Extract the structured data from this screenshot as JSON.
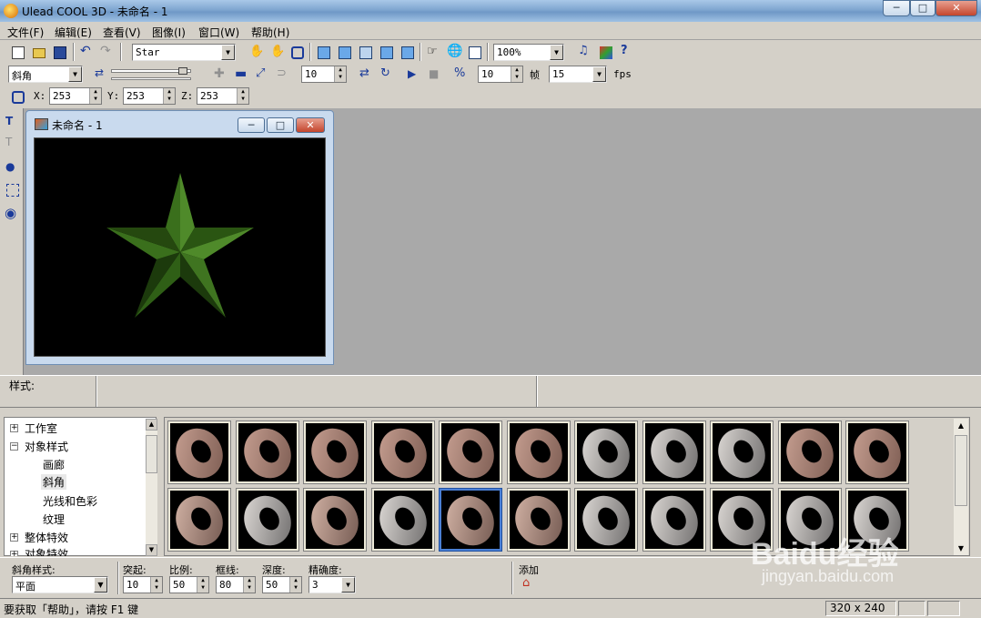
{
  "window": {
    "title": "Ulead COOL 3D - 未命名 - 1",
    "minimize": "─",
    "maximize": "□",
    "close": "✕"
  },
  "menu": [
    "文件(F)",
    "编辑(E)",
    "查看(V)",
    "图像(I)",
    "窗口(W)",
    "帮助(H)"
  ],
  "toolbar1": {
    "font_combo": "Star",
    "zoom_combo": "100%"
  },
  "toolbar2": {
    "object_combo": "斜角",
    "frame_value": "10",
    "frame_value2": "10",
    "frame_label": "帧",
    "fps_value": "15",
    "fps_label": "fps"
  },
  "toolbar3": {
    "x_label": "X:",
    "x_value": "253",
    "y_label": "Y:",
    "y_value": "253",
    "z_label": "Z:",
    "z_value": "253"
  },
  "document": {
    "title": "未命名 - 1"
  },
  "style_panel": {
    "label": "样式:"
  },
  "tree": {
    "items": [
      {
        "label": "工作室",
        "expander": "+"
      },
      {
        "label": "对象样式",
        "expander": "−"
      },
      {
        "label": "画廊"
      },
      {
        "label": "斜角"
      },
      {
        "label": "光线和色彩"
      },
      {
        "label": "纹理"
      },
      {
        "label": "整体特效",
        "expander": "+"
      },
      {
        "label": "对象特效",
        "expander": "+"
      }
    ]
  },
  "bottom": {
    "bevel_style_label": "斜角样式:",
    "bevel_style_value": "平面",
    "protrude_label": "突起:",
    "protrude_value": "10",
    "ratio_label": "比例:",
    "ratio_value": "50",
    "border_label": "框线:",
    "border_value": "80",
    "depth_label": "深度:",
    "depth_value": "50",
    "precision_label": "精确度:",
    "precision_value": "3",
    "add_label": "添加"
  },
  "status": {
    "help_text": "要获取「帮助」，请按 F1 键",
    "size": "320 x 240"
  },
  "colors": {
    "star_light": "#4f8a2a",
    "star_dark": "#1c3a0c",
    "thumb_selected_border": "#4a7fd4",
    "workspace": "#a9a9a9"
  },
  "watermark": {
    "brand": "Baidu经验",
    "url": "jingyan.baidu.com"
  }
}
